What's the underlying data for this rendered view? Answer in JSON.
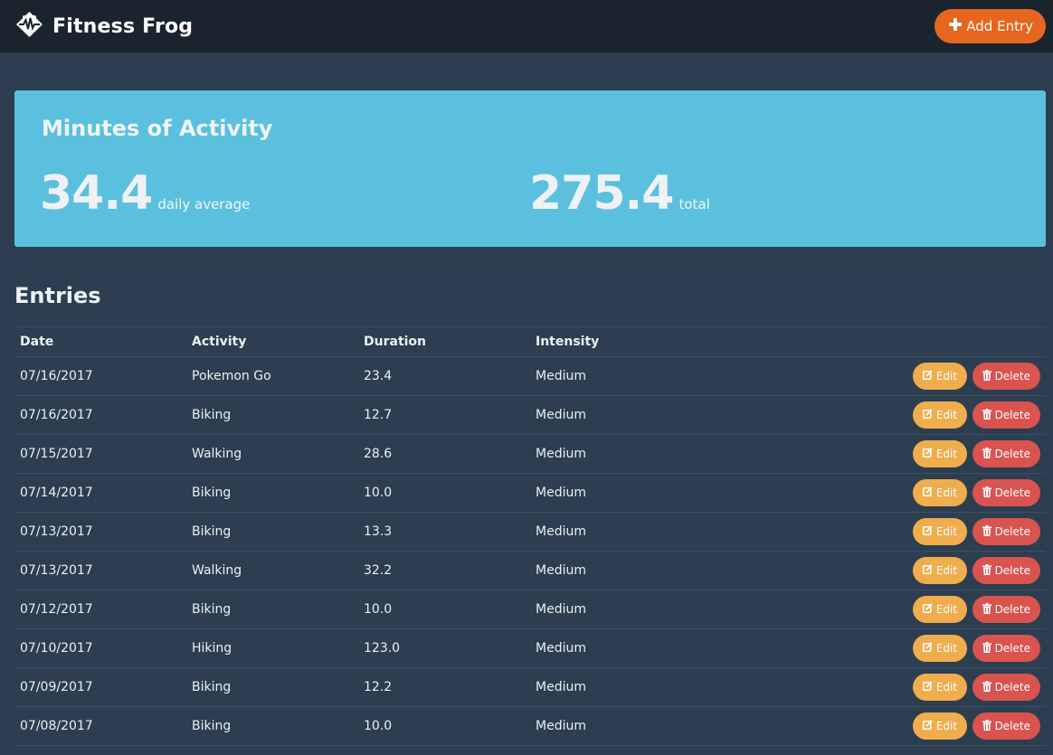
{
  "app": {
    "title": "Fitness Frog"
  },
  "toolbar": {
    "add_label": "Add Entry"
  },
  "summary": {
    "title": "Minutes of Activity",
    "average_value": "34.4",
    "average_label": "daily average",
    "total_value": "275.4",
    "total_label": "total"
  },
  "entries": {
    "heading": "Entries",
    "columns": [
      "Date",
      "Activity",
      "Duration",
      "Intensity"
    ],
    "edit_label": "Edit",
    "delete_label": "Delete",
    "rows": [
      {
        "date": "07/16/2017",
        "activity": "Pokemon Go",
        "duration": "23.4",
        "intensity": "Medium"
      },
      {
        "date": "07/16/2017",
        "activity": "Biking",
        "duration": "12.7",
        "intensity": "Medium"
      },
      {
        "date": "07/15/2017",
        "activity": "Walking",
        "duration": "28.6",
        "intensity": "Medium"
      },
      {
        "date": "07/14/2017",
        "activity": "Biking",
        "duration": "10.0",
        "intensity": "Medium"
      },
      {
        "date": "07/13/2017",
        "activity": "Biking",
        "duration": "13.3",
        "intensity": "Medium"
      },
      {
        "date": "07/13/2017",
        "activity": "Walking",
        "duration": "32.2",
        "intensity": "Medium"
      },
      {
        "date": "07/12/2017",
        "activity": "Biking",
        "duration": "10.0",
        "intensity": "Medium"
      },
      {
        "date": "07/10/2017",
        "activity": "Hiking",
        "duration": "123.0",
        "intensity": "Medium"
      },
      {
        "date": "07/09/2017",
        "activity": "Biking",
        "duration": "12.2",
        "intensity": "Medium"
      },
      {
        "date": "07/08/2017",
        "activity": "Biking",
        "duration": "10.0",
        "intensity": "Medium"
      }
    ]
  },
  "icons": {
    "logo": "frog-logo-icon",
    "add": "plus-icon",
    "edit": "edit-icon",
    "delete": "trash-icon"
  },
  "colors": {
    "navbar": "#1a242f",
    "background": "#2c3e50",
    "accent_orange": "#e6661f",
    "jumbotron": "#5bc0de",
    "edit": "#f0ad4e",
    "delete": "#d9534f"
  }
}
